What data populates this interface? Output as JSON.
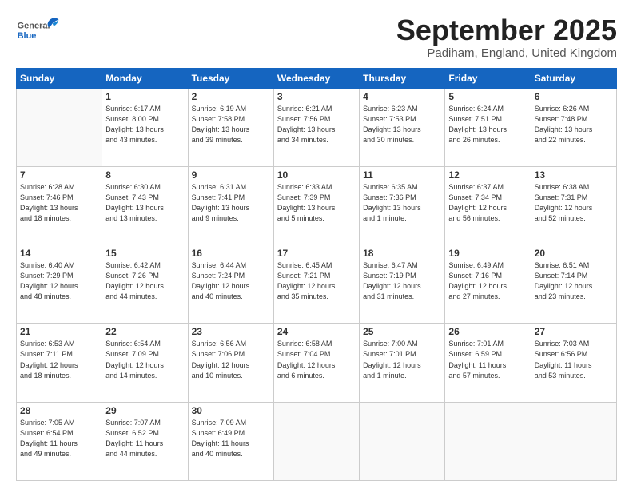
{
  "header": {
    "logo_general": "General",
    "logo_blue": "Blue",
    "month": "September 2025",
    "location": "Padiham, England, United Kingdom"
  },
  "weekdays": [
    "Sunday",
    "Monday",
    "Tuesday",
    "Wednesday",
    "Thursday",
    "Friday",
    "Saturday"
  ],
  "weeks": [
    [
      {
        "day": "",
        "info": ""
      },
      {
        "day": "1",
        "info": "Sunrise: 6:17 AM\nSunset: 8:00 PM\nDaylight: 13 hours\nand 43 minutes."
      },
      {
        "day": "2",
        "info": "Sunrise: 6:19 AM\nSunset: 7:58 PM\nDaylight: 13 hours\nand 39 minutes."
      },
      {
        "day": "3",
        "info": "Sunrise: 6:21 AM\nSunset: 7:56 PM\nDaylight: 13 hours\nand 34 minutes."
      },
      {
        "day": "4",
        "info": "Sunrise: 6:23 AM\nSunset: 7:53 PM\nDaylight: 13 hours\nand 30 minutes."
      },
      {
        "day": "5",
        "info": "Sunrise: 6:24 AM\nSunset: 7:51 PM\nDaylight: 13 hours\nand 26 minutes."
      },
      {
        "day": "6",
        "info": "Sunrise: 6:26 AM\nSunset: 7:48 PM\nDaylight: 13 hours\nand 22 minutes."
      }
    ],
    [
      {
        "day": "7",
        "info": "Sunrise: 6:28 AM\nSunset: 7:46 PM\nDaylight: 13 hours\nand 18 minutes."
      },
      {
        "day": "8",
        "info": "Sunrise: 6:30 AM\nSunset: 7:43 PM\nDaylight: 13 hours\nand 13 minutes."
      },
      {
        "day": "9",
        "info": "Sunrise: 6:31 AM\nSunset: 7:41 PM\nDaylight: 13 hours\nand 9 minutes."
      },
      {
        "day": "10",
        "info": "Sunrise: 6:33 AM\nSunset: 7:39 PM\nDaylight: 13 hours\nand 5 minutes."
      },
      {
        "day": "11",
        "info": "Sunrise: 6:35 AM\nSunset: 7:36 PM\nDaylight: 13 hours\nand 1 minute."
      },
      {
        "day": "12",
        "info": "Sunrise: 6:37 AM\nSunset: 7:34 PM\nDaylight: 12 hours\nand 56 minutes."
      },
      {
        "day": "13",
        "info": "Sunrise: 6:38 AM\nSunset: 7:31 PM\nDaylight: 12 hours\nand 52 minutes."
      }
    ],
    [
      {
        "day": "14",
        "info": "Sunrise: 6:40 AM\nSunset: 7:29 PM\nDaylight: 12 hours\nand 48 minutes."
      },
      {
        "day": "15",
        "info": "Sunrise: 6:42 AM\nSunset: 7:26 PM\nDaylight: 12 hours\nand 44 minutes."
      },
      {
        "day": "16",
        "info": "Sunrise: 6:44 AM\nSunset: 7:24 PM\nDaylight: 12 hours\nand 40 minutes."
      },
      {
        "day": "17",
        "info": "Sunrise: 6:45 AM\nSunset: 7:21 PM\nDaylight: 12 hours\nand 35 minutes."
      },
      {
        "day": "18",
        "info": "Sunrise: 6:47 AM\nSunset: 7:19 PM\nDaylight: 12 hours\nand 31 minutes."
      },
      {
        "day": "19",
        "info": "Sunrise: 6:49 AM\nSunset: 7:16 PM\nDaylight: 12 hours\nand 27 minutes."
      },
      {
        "day": "20",
        "info": "Sunrise: 6:51 AM\nSunset: 7:14 PM\nDaylight: 12 hours\nand 23 minutes."
      }
    ],
    [
      {
        "day": "21",
        "info": "Sunrise: 6:53 AM\nSunset: 7:11 PM\nDaylight: 12 hours\nand 18 minutes."
      },
      {
        "day": "22",
        "info": "Sunrise: 6:54 AM\nSunset: 7:09 PM\nDaylight: 12 hours\nand 14 minutes."
      },
      {
        "day": "23",
        "info": "Sunrise: 6:56 AM\nSunset: 7:06 PM\nDaylight: 12 hours\nand 10 minutes."
      },
      {
        "day": "24",
        "info": "Sunrise: 6:58 AM\nSunset: 7:04 PM\nDaylight: 12 hours\nand 6 minutes."
      },
      {
        "day": "25",
        "info": "Sunrise: 7:00 AM\nSunset: 7:01 PM\nDaylight: 12 hours\nand 1 minute."
      },
      {
        "day": "26",
        "info": "Sunrise: 7:01 AM\nSunset: 6:59 PM\nDaylight: 11 hours\nand 57 minutes."
      },
      {
        "day": "27",
        "info": "Sunrise: 7:03 AM\nSunset: 6:56 PM\nDaylight: 11 hours\nand 53 minutes."
      }
    ],
    [
      {
        "day": "28",
        "info": "Sunrise: 7:05 AM\nSunset: 6:54 PM\nDaylight: 11 hours\nand 49 minutes."
      },
      {
        "day": "29",
        "info": "Sunrise: 7:07 AM\nSunset: 6:52 PM\nDaylight: 11 hours\nand 44 minutes."
      },
      {
        "day": "30",
        "info": "Sunrise: 7:09 AM\nSunset: 6:49 PM\nDaylight: 11 hours\nand 40 minutes."
      },
      {
        "day": "",
        "info": ""
      },
      {
        "day": "",
        "info": ""
      },
      {
        "day": "",
        "info": ""
      },
      {
        "day": "",
        "info": ""
      }
    ]
  ]
}
